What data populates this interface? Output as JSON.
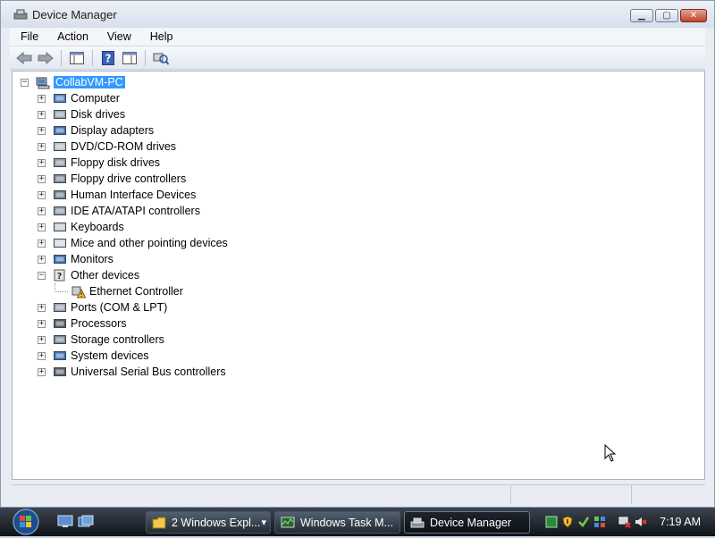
{
  "window": {
    "title": "Device Manager"
  },
  "menu": [
    "File",
    "Action",
    "View",
    "Help"
  ],
  "tree": {
    "root": "CollabVM-PC",
    "categories": [
      {
        "label": "Computer",
        "icon": "computer-icon",
        "expander": "+"
      },
      {
        "label": "Disk drives",
        "icon": "disk-drive-icon",
        "expander": "+"
      },
      {
        "label": "Display adapters",
        "icon": "display-adapter-icon",
        "expander": "+"
      },
      {
        "label": "DVD/CD-ROM drives",
        "icon": "dvd-drive-icon",
        "expander": "+"
      },
      {
        "label": "Floppy disk drives",
        "icon": "floppy-drive-icon",
        "expander": "+"
      },
      {
        "label": "Floppy drive controllers",
        "icon": "floppy-controller-icon",
        "expander": "+"
      },
      {
        "label": "Human Interface Devices",
        "icon": "hid-icon",
        "expander": "+"
      },
      {
        "label": "IDE ATA/ATAPI controllers",
        "icon": "ide-controller-icon",
        "expander": "+"
      },
      {
        "label": "Keyboards",
        "icon": "keyboard-icon",
        "expander": "+"
      },
      {
        "label": "Mice and other pointing devices",
        "icon": "mouse-icon",
        "expander": "+"
      },
      {
        "label": "Monitors",
        "icon": "monitor-icon",
        "expander": "+"
      },
      {
        "label": "Other devices",
        "icon": "unknown-device-icon",
        "expander": "−"
      },
      {
        "label": "Ethernet Controller",
        "icon": "warning-device-icon",
        "child": true
      },
      {
        "label": "Ports (COM & LPT)",
        "icon": "port-icon",
        "expander": "+"
      },
      {
        "label": "Processors",
        "icon": "processor-icon",
        "expander": "+"
      },
      {
        "label": "Storage controllers",
        "icon": "storage-controller-icon",
        "expander": "+"
      },
      {
        "label": "System devices",
        "icon": "system-device-icon",
        "expander": "+"
      },
      {
        "label": "Universal Serial Bus controllers",
        "icon": "usb-icon",
        "expander": "+"
      }
    ]
  },
  "taskbar": {
    "tasks": [
      {
        "label": "2 Windows Expl...",
        "icon": "folder-icon"
      },
      {
        "label": "Windows Task M...",
        "icon": "task-manager-icon"
      },
      {
        "label": "Device Manager",
        "icon": "device-manager-icon",
        "active": true
      }
    ],
    "clock": "7:19 AM"
  },
  "colors": {
    "selection": "#3399ff",
    "taskbar": "#1a1f26"
  }
}
